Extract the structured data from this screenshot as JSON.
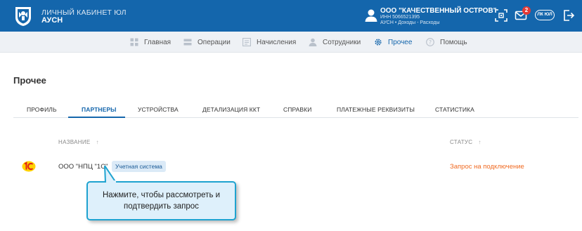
{
  "header": {
    "brand_line1": "ЛИЧНЫЙ КАБИНЕТ ЮЛ",
    "brand_line2": "АУСН",
    "org_name": "ООО \"КАЧЕСТВЕННЫЙ ОСТРОВ\"",
    "org_inn": "ИНН 5066521395",
    "org_regime": "АУСН • Доходы - Расходы",
    "notifications_count": "2",
    "lk_switch_label": "ЛК ЮЛ",
    "icons": [
      "emblem-icon",
      "user-icon",
      "qr-scan-icon",
      "mail-icon",
      "logout-icon"
    ]
  },
  "nav": {
    "items": [
      {
        "label": "Главная",
        "icon": "dashboard-icon"
      },
      {
        "label": "Операции",
        "icon": "operations-icon"
      },
      {
        "label": "Начисления",
        "icon": "accruals-icon"
      },
      {
        "label": "Сотрудники",
        "icon": "employees-icon"
      },
      {
        "label": "Прочее",
        "icon": "gear-icon",
        "active": true
      },
      {
        "label": "Помощь",
        "icon": "help-icon"
      }
    ]
  },
  "page": {
    "title": "Прочее",
    "tabs": [
      {
        "label": "ПРОФИЛЬ"
      },
      {
        "label": "ПАРТНЕРЫ",
        "active": true
      },
      {
        "label": "УСТРОЙСТВА"
      },
      {
        "label": "ДЕТАЛИЗАЦИЯ ККТ"
      },
      {
        "label": "СПРАВКИ"
      },
      {
        "label": "ПЛАТЕЖНЫЕ РЕКВИЗИТЫ"
      },
      {
        "label": "СТАТИСТИКА"
      }
    ]
  },
  "table": {
    "columns": [
      {
        "label": "НАЗВАНИЕ",
        "sort_icon": "↑"
      },
      {
        "label": "СТАТУС",
        "sort_icon": "↑"
      }
    ],
    "rows": [
      {
        "logo": "1c-logo",
        "name": "ООО \"НПЦ \"1С\"",
        "tag": "Учетная система",
        "status": "Запрос на подключение"
      }
    ]
  },
  "tooltip": {
    "line1": "Нажмите, чтобы рассмотреть и",
    "line2": "подтвердить запрос"
  },
  "colors": {
    "header_bg": "#1466ac",
    "nav_bg": "#eef1f5",
    "accent": "#1466ac",
    "status_pending": "#f06b23",
    "tag_bg": "#dbeaf7",
    "tooltip_bg": "#def0fb",
    "tooltip_border": "#1ea3d0",
    "badge": "#e53935"
  }
}
